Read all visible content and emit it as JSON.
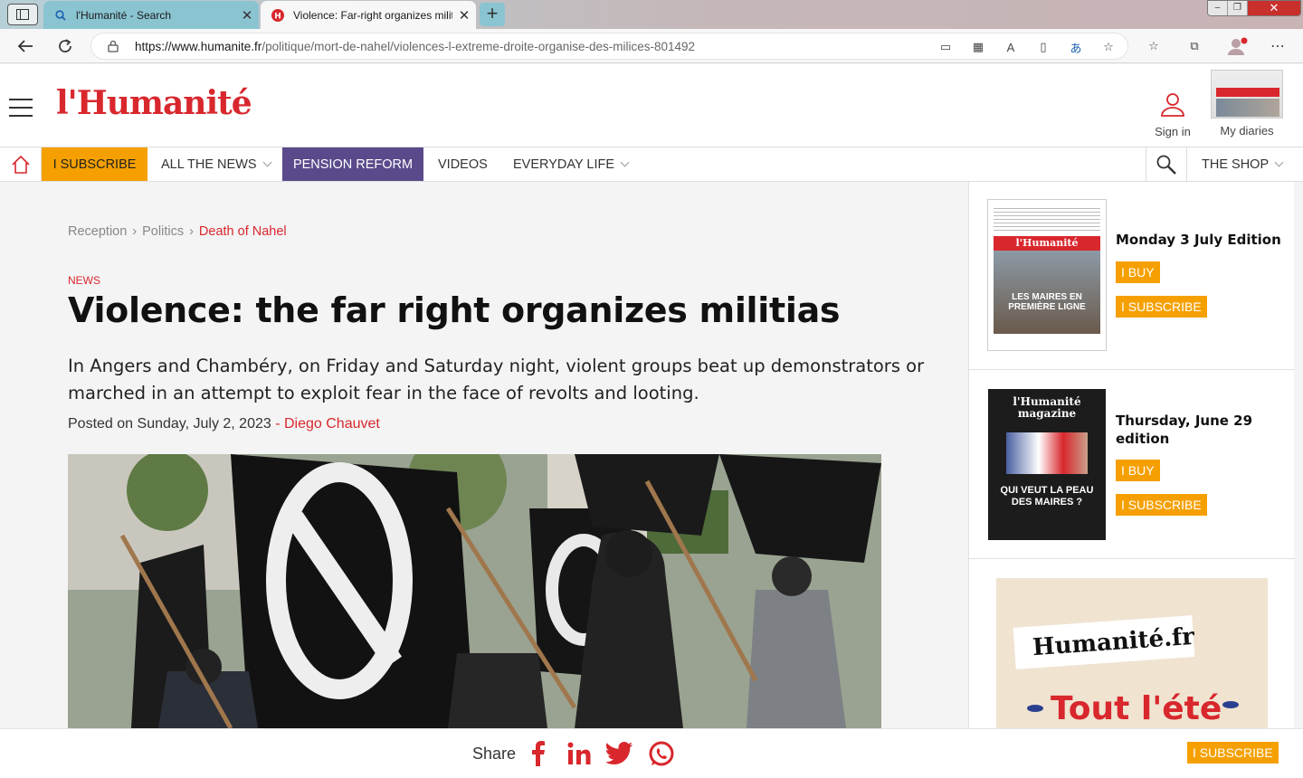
{
  "browser": {
    "tabs": [
      {
        "title": "l'Humanité - Search",
        "icon": "search-icon"
      },
      {
        "title": "Violence: Far-right organizes militias",
        "icon": "humanite-favicon"
      }
    ],
    "url_host": "https://www.humanite.fr",
    "url_path": "/politique/mort-de-nahel/violences-l-extreme-droite-organise-des-milices-801492"
  },
  "header": {
    "logo": "l'Humanité",
    "sign_in": "Sign in",
    "my_diaries": "My diaries"
  },
  "nav": {
    "subscribe": "I SUBSCRIBE",
    "all_news": "ALL THE NEWS",
    "pension_reform": "PENSION REFORM",
    "videos": "VIDEOS",
    "everyday_life": "EVERYDAY LIFE",
    "shop": "THE SHOP"
  },
  "article": {
    "breadcrumb": [
      "Reception",
      "Politics",
      "Death of Nahel"
    ],
    "kicker": "NEWS",
    "title": "Violence: the far right organizes militias",
    "lede": "In Angers and Chambéry, on Friday and Saturday night, violent groups beat up demonstrators or marched in an attempt to exploit fear in the face of revolts and looting.",
    "posted_prefix": "Posted on",
    "date": "Sunday, July 2, 2023",
    "author": "- Diego Chauvet"
  },
  "sidebar": {
    "editions": [
      {
        "title": "Monday 3 July Edition",
        "buy": "I BUY",
        "subscribe": "I SUBSCRIBE",
        "cover_text": "LES MAIRES EN PREMIÈRE LIGNE",
        "cover_logo": "l'Humanité"
      },
      {
        "title": "Thursday, June 29 edition",
        "buy": "I BUY",
        "subscribe": "I SUBSCRIBE",
        "cover_text": "QUI VEUT LA PEAU DES MAIRES ?",
        "cover_logo": "l'Humanité magazine"
      }
    ],
    "promo": {
      "brand": "Humanité.fr",
      "headline": "Tout l'été"
    }
  },
  "share": {
    "label": "Share",
    "networks": [
      "facebook-icon",
      "linkedin-icon",
      "twitter-icon",
      "whatsapp-icon"
    ],
    "subscribe": "I SUBSCRIBE"
  },
  "colors": {
    "brand_red": "#d8272d",
    "subscribe_yellow": "#f5a000",
    "pension_purple": "#5b4a8b",
    "tab_active_bg": "#8ac4d1"
  }
}
